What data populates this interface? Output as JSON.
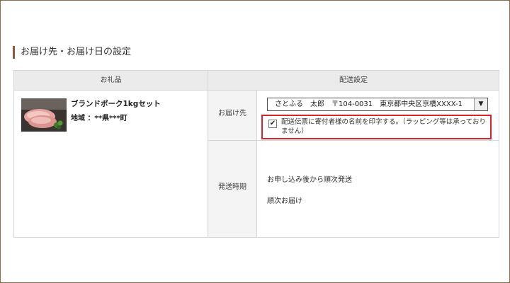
{
  "section": {
    "title": "お届け先・お届け日の設定"
  },
  "table": {
    "header_gift": "お礼品",
    "header_shipping": "配送設定"
  },
  "product": {
    "name": "ブランドポーク1kgセット",
    "region": "地域 ：**県***町",
    "image": "pork-cutlet-photo"
  },
  "destination": {
    "label": "お届け先",
    "selected": "さとふる　太郎　〒104-0031　東京都中央区京橋XXXX-1",
    "print_name_checked": true,
    "print_name_label": "配送伝票に寄付者様の名前を印字する。（ラッピング等は承っておりません）"
  },
  "timing": {
    "label": "発送時期",
    "shipping": "お申し込み後から順次発送",
    "delivery": "順次お届け"
  },
  "colors": {
    "frame_border": "#8a6a4a",
    "title_bar": "#8a5a3a",
    "highlight": "#d9232d",
    "header_bg": "#ebebeb",
    "label_bg": "#f4f4f4"
  }
}
